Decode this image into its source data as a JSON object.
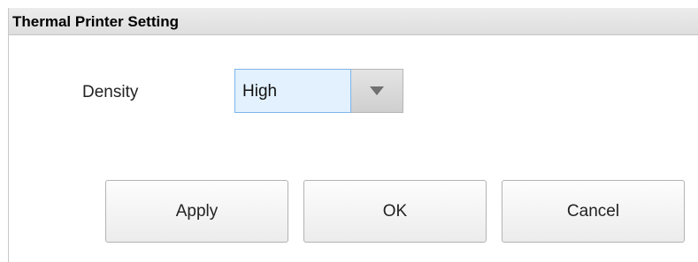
{
  "window": {
    "title": "Thermal Printer Setting"
  },
  "density": {
    "label": "Density",
    "selected": "High"
  },
  "buttons": {
    "apply": "Apply",
    "ok": "OK",
    "cancel": "Cancel"
  },
  "icons": {
    "dropdown": "chevron-down-icon"
  },
  "colors": {
    "title_bar": "#e5e5e5",
    "select_highlight": "#e2f1fd",
    "select_border": "#7eb4ea"
  }
}
